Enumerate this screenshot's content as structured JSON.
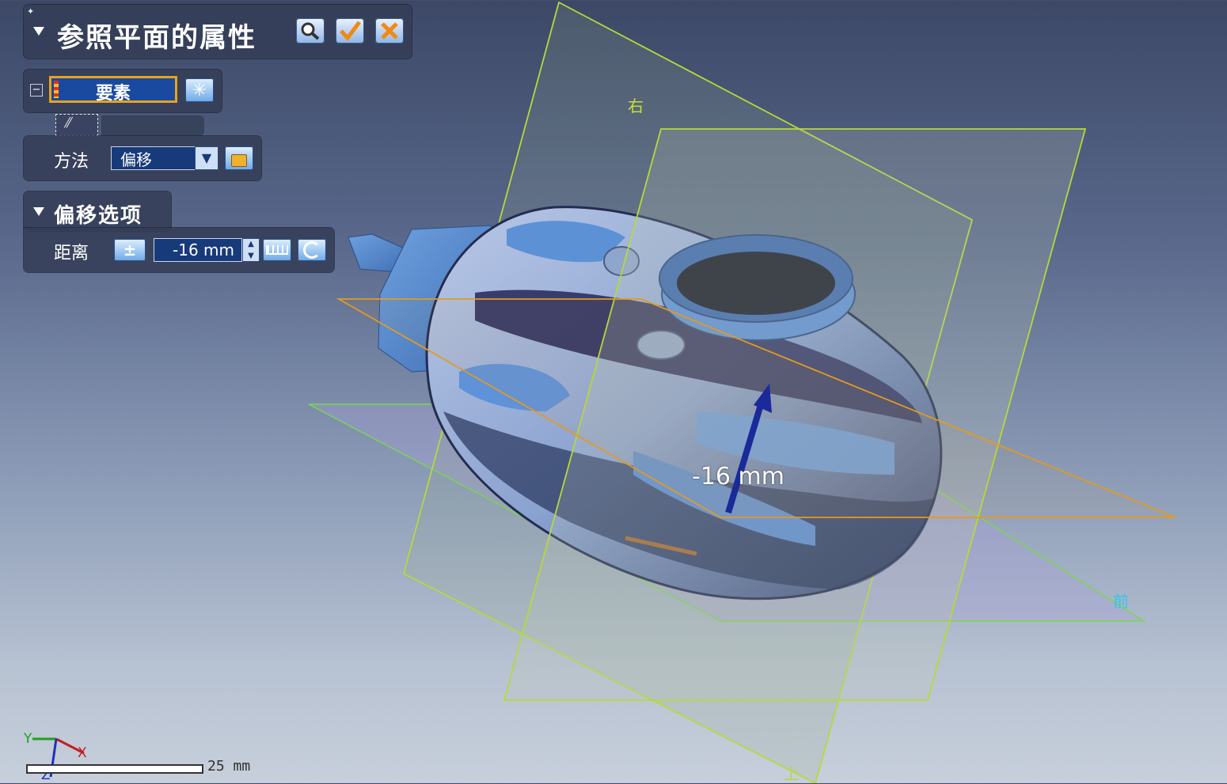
{
  "dialog": {
    "title": "参照平面的属性",
    "elements_label": "要素",
    "method_label": "方法",
    "method_value": "偏移",
    "offset_section_title": "偏移选项",
    "distance_label": "距离",
    "distance_value": "-16 mm"
  },
  "viewport": {
    "plane_label_right": "右",
    "plane_label_front": "前",
    "plane_label_top": "上",
    "dimension_label": "-16 mm"
  },
  "triad": {
    "x": "X",
    "y": "Y",
    "z": "Z"
  },
  "scale_bar": {
    "label": "25 mm"
  },
  "colors": {
    "plane_green": "#b7d83a",
    "plane_orange": "#e39a20",
    "arrow_blue": "#1a2a9a",
    "panel_bg": "#343e56",
    "field_blue": "#173a7a"
  }
}
